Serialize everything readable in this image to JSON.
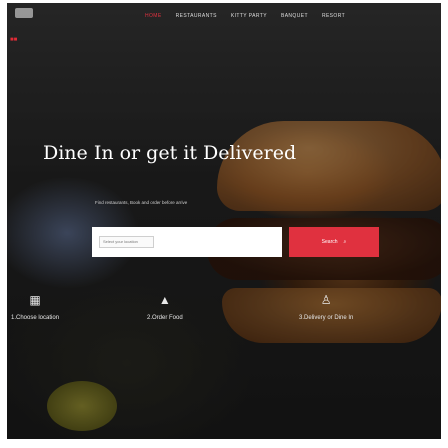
{
  "nav": {
    "items": [
      "HOME",
      "RESTAURANTS",
      "KITTY PARTY",
      "BANQUET",
      "RESORT"
    ],
    "active_color": "#e0313f"
  },
  "hero": {
    "title": "Dine In or get it Delivered",
    "subtitle": "Find restaurants, Book and order before arrive"
  },
  "search": {
    "select_placeholder": "Select your location",
    "button_label": "Search",
    "button_icon": "search-icon",
    "accent": "#e0313f"
  },
  "steps": [
    {
      "icon": "store-icon",
      "label": "1.Choose location"
    },
    {
      "icon": "burger-icon",
      "label": "2.Order Food"
    },
    {
      "icon": "rider-icon",
      "label": "3.Delivery or Dine In"
    }
  ]
}
